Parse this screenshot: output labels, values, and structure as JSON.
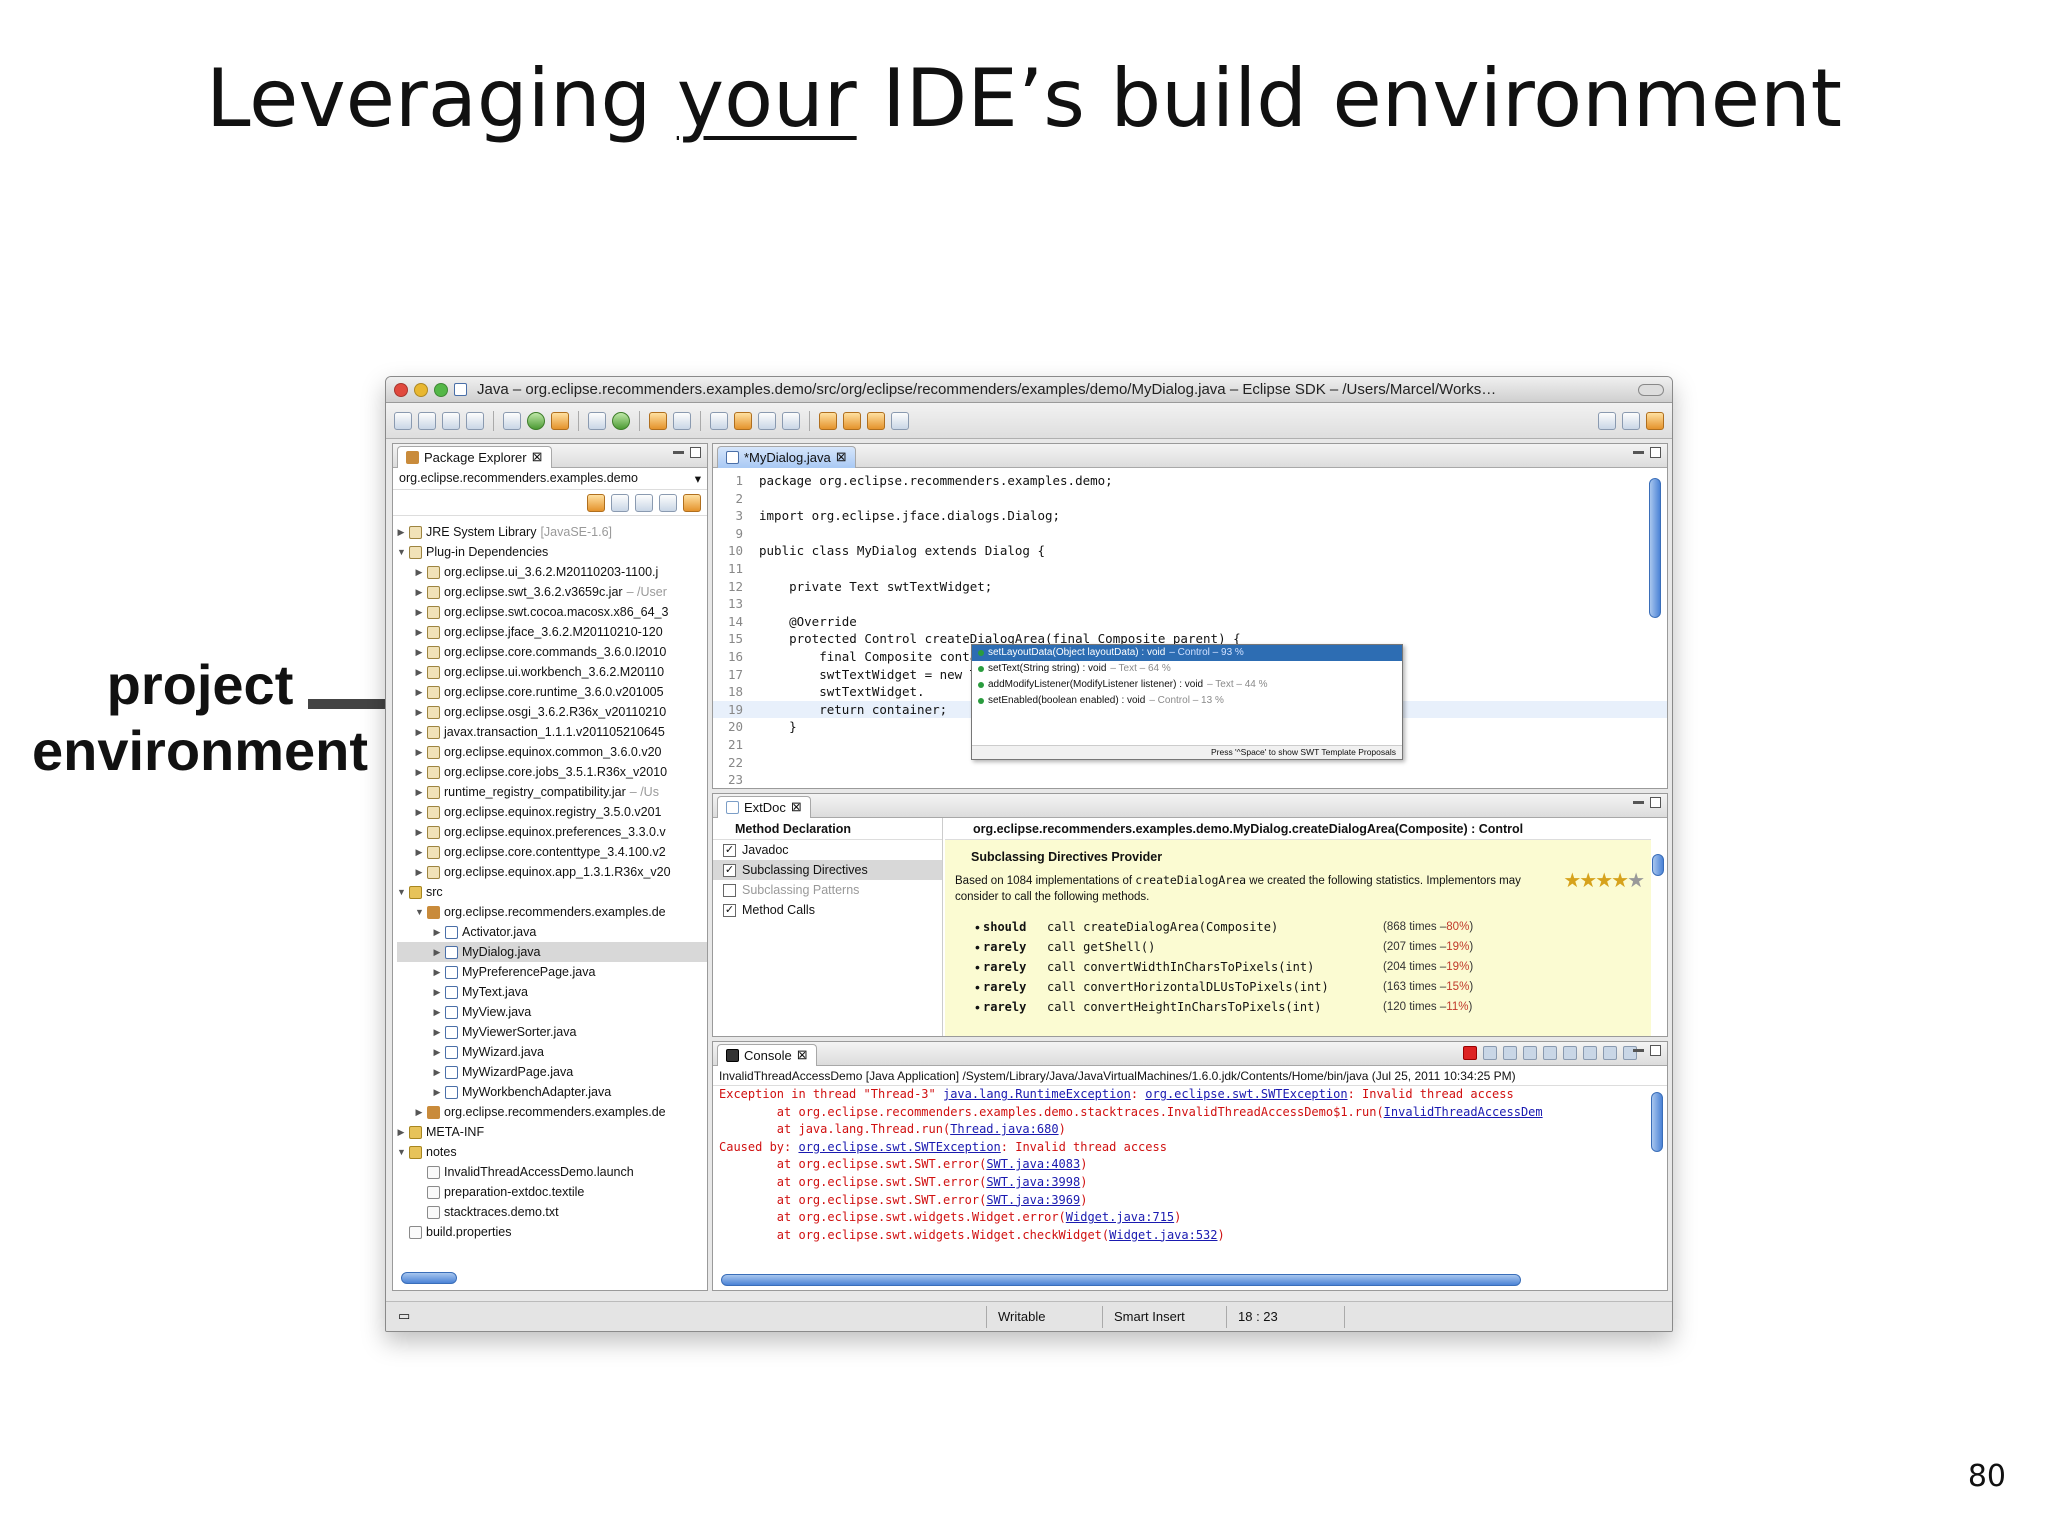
{
  "slide": {
    "title_pre": "Leveraging ",
    "title_under": "your",
    "title_post": " IDE’s build environment",
    "callout_line1": "project",
    "callout_line2": "environment",
    "page_number": "80"
  },
  "window": {
    "title": "Java – org.eclipse.recommenders.examples.demo/src/org/eclipse/recommenders/examples/demo/MyDialog.java – Eclipse SDK – /Users/Marcel/Works…"
  },
  "package_explorer": {
    "tab": "Package Explorer",
    "filter": "org.eclipse.recommenders.examples.demo",
    "items": [
      {
        "label": "JRE System Library",
        "muted": "[JavaSE-1.6]"
      },
      {
        "label": "Plug-in Dependencies",
        "muted": ""
      },
      {
        "label": "org.eclipse.ui_3.6.2.M20110203-1100.j",
        "muted": ""
      },
      {
        "label": "org.eclipse.swt_3.6.2.v3659c.jar",
        "muted": " – /User"
      },
      {
        "label": "org.eclipse.swt.cocoa.macosx.x86_64_3",
        "muted": ""
      },
      {
        "label": "org.eclipse.jface_3.6.2.M20110210-120",
        "muted": ""
      },
      {
        "label": "org.eclipse.core.commands_3.6.0.I2010",
        "muted": ""
      },
      {
        "label": "org.eclipse.ui.workbench_3.6.2.M20110",
        "muted": ""
      },
      {
        "label": "org.eclipse.core.runtime_3.6.0.v201005",
        "muted": ""
      },
      {
        "label": "org.eclipse.osgi_3.6.2.R36x_v20110210",
        "muted": ""
      },
      {
        "label": "javax.transaction_1.1.1.v201105210645",
        "muted": ""
      },
      {
        "label": "org.eclipse.equinox.common_3.6.0.v20",
        "muted": ""
      },
      {
        "label": "org.eclipse.core.jobs_3.5.1.R36x_v2010",
        "muted": ""
      },
      {
        "label": "runtime_registry_compatibility.jar",
        "muted": " – /Us"
      },
      {
        "label": "org.eclipse.equinox.registry_3.5.0.v201",
        "muted": ""
      },
      {
        "label": "org.eclipse.equinox.preferences_3.3.0.v",
        "muted": ""
      },
      {
        "label": "org.eclipse.core.contenttype_3.4.100.v2",
        "muted": ""
      },
      {
        "label": "org.eclipse.equinox.app_1.3.1.R36x_v20",
        "muted": ""
      },
      {
        "label": "src",
        "muted": ""
      },
      {
        "label": "org.eclipse.recommenders.examples.de",
        "muted": ""
      },
      {
        "label": "Activator.java",
        "muted": ""
      },
      {
        "label": "MyDialog.java",
        "muted": ""
      },
      {
        "label": "MyPreferencePage.java",
        "muted": ""
      },
      {
        "label": "MyText.java",
        "muted": ""
      },
      {
        "label": "MyView.java",
        "muted": ""
      },
      {
        "label": "MyViewerSorter.java",
        "muted": ""
      },
      {
        "label": "MyWizard.java",
        "muted": ""
      },
      {
        "label": "MyWizardPage.java",
        "muted": ""
      },
      {
        "label": "MyWorkbenchAdapter.java",
        "muted": ""
      },
      {
        "label": "org.eclipse.recommenders.examples.de",
        "muted": ""
      },
      {
        "label": "META-INF",
        "muted": ""
      },
      {
        "label": "notes",
        "muted": ""
      },
      {
        "label": "InvalidThreadAccessDemo.launch",
        "muted": ""
      },
      {
        "label": "preparation-extdoc.textile",
        "muted": ""
      },
      {
        "label": "stacktraces.demo.txt",
        "muted": ""
      },
      {
        "label": "build.properties",
        "muted": ""
      }
    ]
  },
  "editor": {
    "tab": "*MyDialog.java",
    "lines": [
      {
        "n": "1",
        "t": "package org.eclipse.recommenders.examples.demo;"
      },
      {
        "n": "2",
        "t": ""
      },
      {
        "n": "3",
        "t": "import org.eclipse.jface.dialogs.Dialog;"
      },
      {
        "n": "9",
        "t": ""
      },
      {
        "n": "10",
        "t": "public class MyDialog extends Dialog {"
      },
      {
        "n": "11",
        "t": ""
      },
      {
        "n": "12",
        "t": "    private Text swtTextWidget;"
      },
      {
        "n": "13",
        "t": ""
      },
      {
        "n": "14",
        "t": "    @Override"
      },
      {
        "n": "15",
        "t": "    protected Control createDialogArea(final Composite parent) {"
      },
      {
        "n": "16",
        "t": "        final Composite container = createContainer(parent);"
      },
      {
        "n": "17",
        "t": "        swtTextWidget = new Text(container, SWT.NONE);"
      },
      {
        "n": "18",
        "t": "        swtTextWidget."
      },
      {
        "n": "19",
        "t": "        return container;"
      },
      {
        "n": "20",
        "t": "    }"
      },
      {
        "n": "21",
        "t": ""
      },
      {
        "n": "22",
        "t": ""
      },
      {
        "n": "23",
        "t": ""
      }
    ],
    "autocomplete": {
      "items": [
        {
          "sig": "setLayoutData(Object layoutData) : void",
          "meta": " – Control – 93 %"
        },
        {
          "sig": "setText(String string) : void",
          "meta": " – Text – 64 %"
        },
        {
          "sig": "addModifyListener(ModifyListener listener) : void",
          "meta": " – Text – 44 %"
        },
        {
          "sig": "setEnabled(boolean enabled) : void",
          "meta": " – Control – 13 %"
        }
      ],
      "footer": "Press '^Space' to show SWT Template Proposals"
    }
  },
  "extdoc": {
    "tab": "ExtDoc",
    "left_header": "Method Declaration",
    "providers": [
      {
        "label": "Javadoc",
        "checked": true
      },
      {
        "label": "Subclassing Directives",
        "checked": true
      },
      {
        "label": "Subclassing Patterns",
        "checked": false
      },
      {
        "label": "Method Calls",
        "checked": true
      }
    ],
    "right_header": "org.eclipse.recommenders.examples.demo.MyDialog.createDialogArea(Composite) : Control",
    "provider_title": "Subclassing Directives Provider",
    "para_pre": "Based on 1084 implementations of ",
    "para_code": "createDialogArea",
    "para_post": " we created the following statistics. Implementors may consider to call the following methods.",
    "rating_stars": 4,
    "stats": [
      {
        "w": "should",
        "call": "call createDialogArea(Composite)",
        "times": "(868 times – ",
        "pct": "80%",
        "close": ")"
      },
      {
        "w": "rarely",
        "call": "call getShell()",
        "times": "(207 times – ",
        "pct": "19%",
        "close": ")"
      },
      {
        "w": "rarely",
        "call": "call convertWidthInCharsToPixels(int)",
        "times": "(204 times – ",
        "pct": "19%",
        "close": ")"
      },
      {
        "w": "rarely",
        "call": "call convertHorizontalDLUsToPixels(int)",
        "times": "(163 times – ",
        "pct": "15%",
        "close": ")"
      },
      {
        "w": "rarely",
        "call": "call convertHeightInCharsToPixels(int)",
        "times": "(120 times – ",
        "pct": "11%",
        "close": ")"
      }
    ]
  },
  "console": {
    "tab": "Console",
    "desc": "InvalidThreadAccessDemo [Java Application] /System/Library/Java/JavaVirtualMachines/1.6.0.jdk/Contents/Home/bin/java (Jul 25, 2011 10:34:25 PM)",
    "lines": [
      {
        "pre": "Exception in thread \"Thread-3\" ",
        "link": "java.lang.RuntimeException",
        "mid": ": ",
        "link2": "org.eclipse.swt.SWTException",
        "post": ": Invalid thread access"
      },
      {
        "pre": "        at org.eclipse.recommenders.examples.demo.stacktraces.InvalidThreadAccessDemo$1.run(",
        "link": "InvalidThreadAccessDem",
        "mid": "",
        "link2": "",
        "post": ""
      },
      {
        "pre": "        at java.lang.Thread.run(",
        "link": "Thread.java:680",
        "mid": ")",
        "link2": "",
        "post": ""
      },
      {
        "pre": "Caused by: ",
        "link": "org.eclipse.swt.SWTException",
        "mid": ": Invalid thread access",
        "link2": "",
        "post": ""
      },
      {
        "pre": "        at org.eclipse.swt.SWT.error(",
        "link": "SWT.java:4083",
        "mid": ")",
        "link2": "",
        "post": ""
      },
      {
        "pre": "        at org.eclipse.swt.SWT.error(",
        "link": "SWT.java:3998",
        "mid": ")",
        "link2": "",
        "post": ""
      },
      {
        "pre": "        at org.eclipse.swt.SWT.error(",
        "link": "SWT.java:3969",
        "mid": ")",
        "link2": "",
        "post": ""
      },
      {
        "pre": "        at org.eclipse.swt.widgets.Widget.error(",
        "link": "Widget.java:715",
        "mid": ")",
        "link2": "",
        "post": ""
      },
      {
        "pre": "        at org.eclipse.swt.widgets.Widget.checkWidget(",
        "link": "Widget.java:532",
        "mid": ")",
        "link2": "",
        "post": ""
      }
    ]
  },
  "statusbar": {
    "writable": "Writable",
    "insert_mode": "Smart Insert",
    "position": "18 : 23"
  }
}
